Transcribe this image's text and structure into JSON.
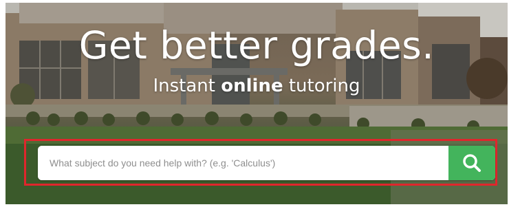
{
  "hero": {
    "headline": "Get better grades.",
    "subline_prefix": "Instant ",
    "subline_bold": "online",
    "subline_suffix": " tutoring"
  },
  "search": {
    "placeholder": "What subject do you need help with? (e.g. 'Calculus')",
    "value": "",
    "button_icon": "search-icon"
  },
  "colors": {
    "accent_green": "#43b45c",
    "highlight_red": "#e0262c",
    "headline_text": "#ffffff"
  }
}
